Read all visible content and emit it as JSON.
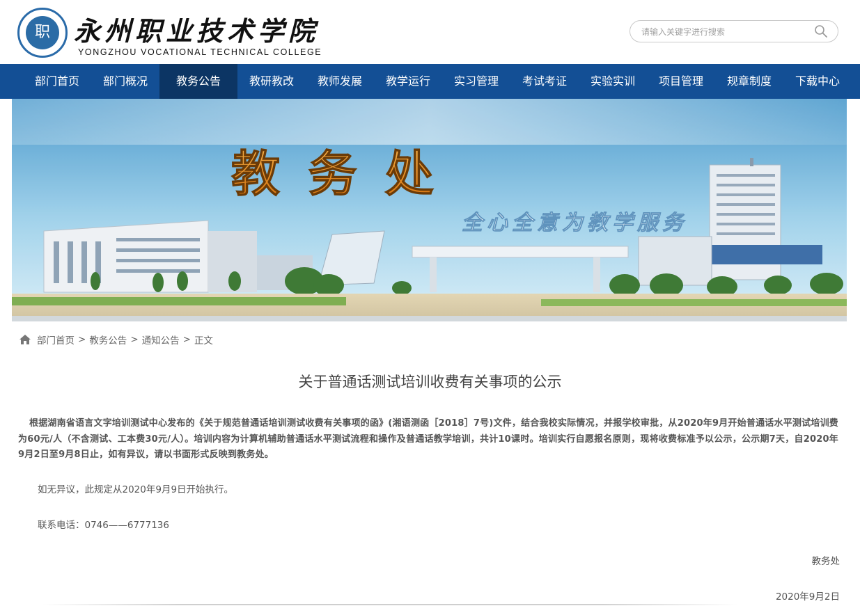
{
  "header": {
    "logo_badge_text": "职",
    "college_name_cn": "永州职业技术学院",
    "college_name_en": "YONGZHOU VOCATIONAL TECHNICAL COLLEGE",
    "search_placeholder": "请输入关键字进行搜索",
    "search_icon": "search-icon"
  },
  "nav": {
    "items": [
      "部门首页",
      "部门概况",
      "教务公告",
      "教研教改",
      "教师发展",
      "教学运行",
      "实习管理",
      "考试考证",
      "实验实训",
      "项目管理",
      "规章制度",
      "下载中心"
    ],
    "active": "教务公告"
  },
  "banner": {
    "title": "教 务 处",
    "slogan": "全心全意为教学服务"
  },
  "breadcrumb": {
    "items": [
      "部门首页",
      "教务公告",
      "通知公告",
      "正文"
    ],
    "separator": ">"
  },
  "article": {
    "title": "关于普通话测试培训收费有关事项的公示",
    "paragraph1": "根据湖南省语言文字培训测试中心发布的《关于规范普通话培训测试收费有关事项的函》(湘语测函［2018］7号)文件，结合我校实际情况，并报学校审批，从2020年9月开始普通话水平测试培训费为60元/人（不含测试、工本费30元/人）。培训内容为计算机辅助普通话水平测试流程和操作及普通话教学培训，共计10课时。培训实行自愿报名原则，现将收费标准予以公示，公示期7天，自2020年9月2日至9月8日止，如有异议，请以书面形式反映到教务处。",
    "paragraph2": "如无异议，此规定从2020年9月9日开始执行。",
    "paragraph3": "联系电话：0746——6777136",
    "signature": "教务处",
    "date": "2020年9月2日"
  },
  "colors": {
    "nav_bg": "#134f95",
    "nav_active": "#0c3564",
    "banner_title": "#e88a1a"
  }
}
